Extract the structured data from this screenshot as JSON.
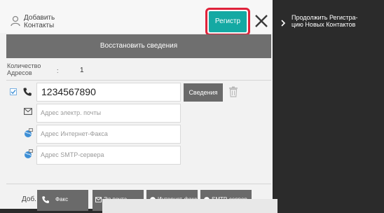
{
  "header": {
    "title_line1": "Добавить",
    "title_line2": "Контакты",
    "register_label": "Регистр"
  },
  "restore_label": "Восстановить сведения",
  "address_count": {
    "label_line1": "Количество",
    "label_line2": "Адресов",
    "colon": ":",
    "value": "1"
  },
  "fields": {
    "phone_value": "1234567890",
    "email_placeholder": "Адрес электр. почты",
    "ifax_placeholder": "Адрес Интернет-Факса",
    "smtp_placeholder": "Адрес SMTP-сервера"
  },
  "details_label": "Сведения",
  "bottom": {
    "add_label": "Доб.",
    "tabs": [
      "Факс",
      "Эл.почта",
      "Интернет-факс",
      "SMTP-сервер"
    ]
  },
  "right_panel": {
    "title_line1": "Продолжить Регистра-",
    "title_line2": "цию Новых Контактов"
  },
  "icons": [
    "person-icon",
    "close-icon",
    "phone-icon",
    "checkbox-icon",
    "trash-icon",
    "mail-icon",
    "globe-icon",
    "chevron-right-icon"
  ],
  "colors": {
    "accent": "#14a9a3",
    "highlight": "#e0223a",
    "button_gray": "#6a6a6a"
  }
}
